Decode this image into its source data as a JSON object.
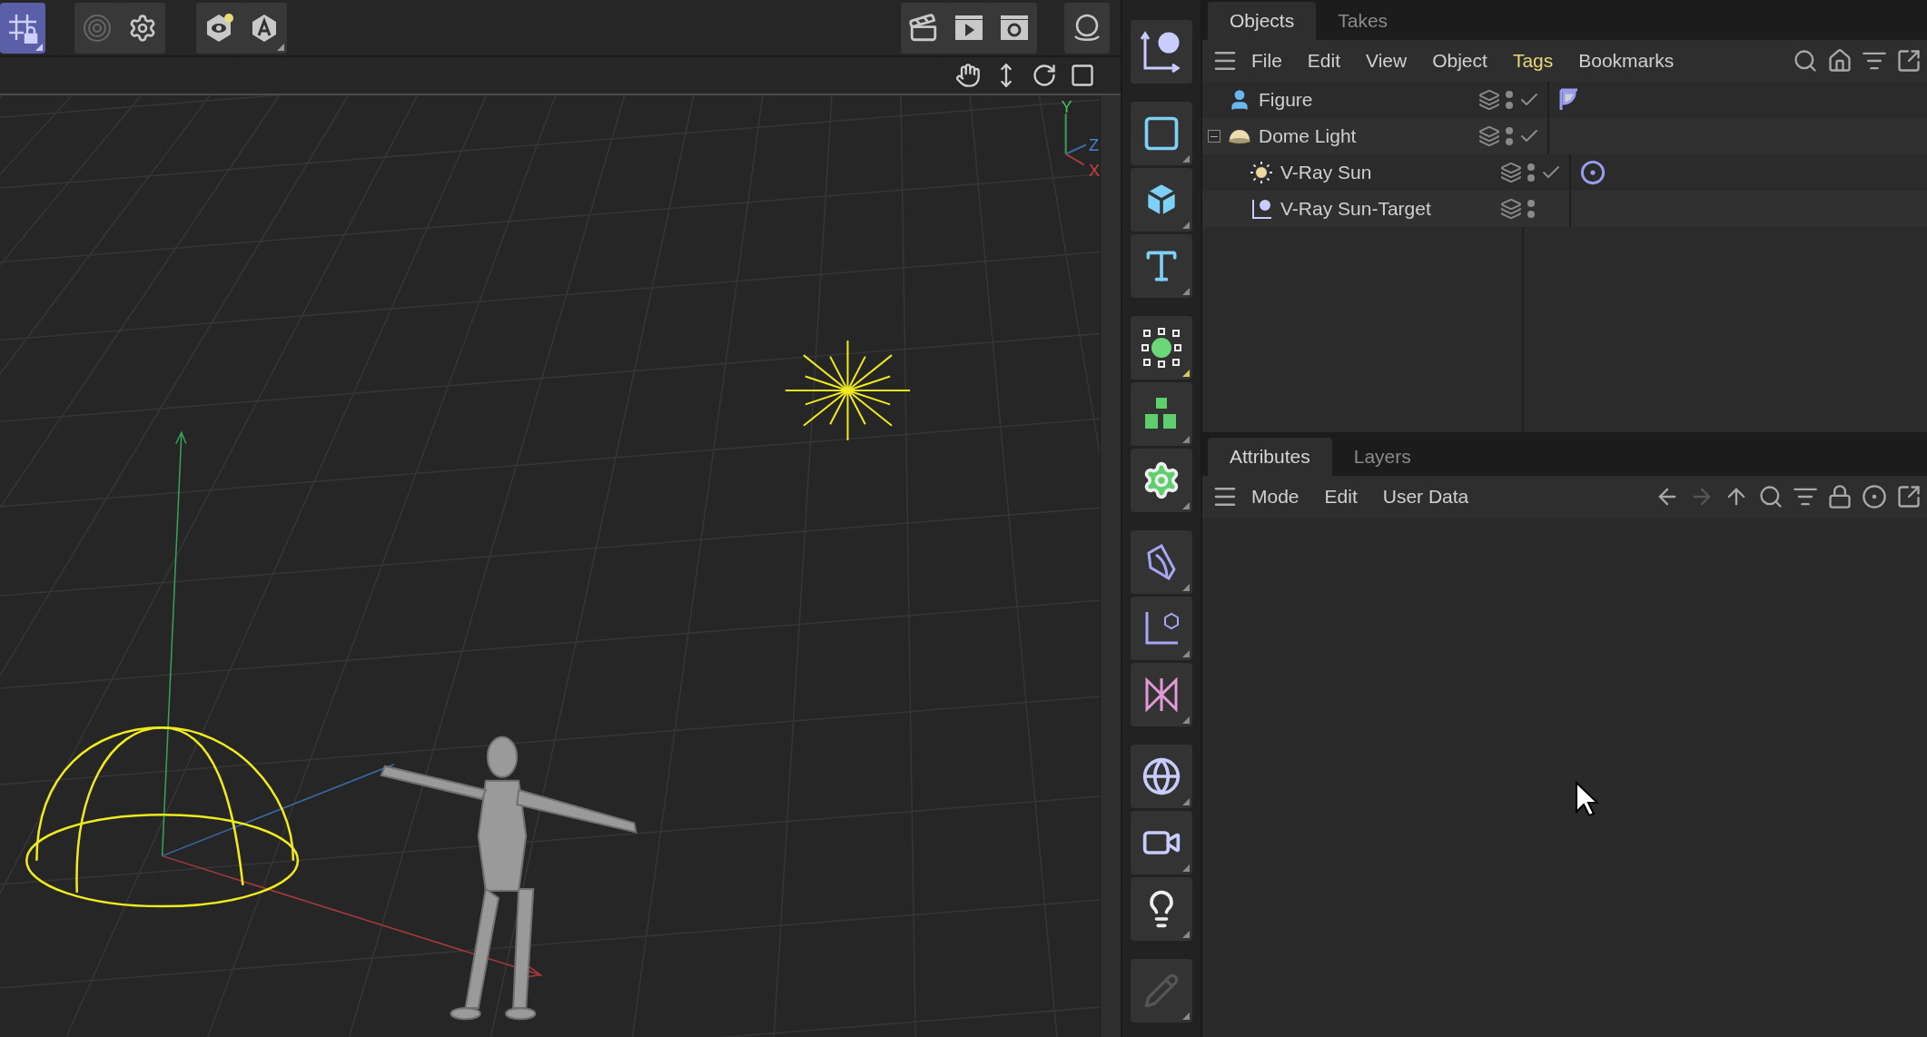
{
  "toolbar": {
    "left": [
      {
        "kind": "snap",
        "selected": true
      },
      {
        "kind": "rings",
        "selected": false
      },
      {
        "kind": "gear",
        "selected": false
      },
      {
        "kind": "eye",
        "selected": false
      },
      {
        "kind": "letter",
        "selected": false
      }
    ],
    "right": [
      {
        "kind": "clapper",
        "selected": false
      },
      {
        "kind": "play",
        "selected": false
      },
      {
        "kind": "render-settings",
        "selected": false
      },
      {
        "kind": "bulb-round",
        "selected": false
      }
    ]
  },
  "viewport": {
    "axis_labels": [
      "Y",
      "Z",
      "X"
    ]
  },
  "tool_strip": [
    {
      "tools": [
        {
          "kind": "null"
        }
      ]
    },
    {
      "tools": [
        {
          "kind": "square"
        },
        {
          "kind": "cube"
        },
        {
          "kind": "text"
        }
      ]
    },
    {
      "tools": [
        {
          "kind": "points"
        },
        {
          "kind": "blocks"
        },
        {
          "kind": "cog"
        }
      ]
    },
    {
      "tools": [
        {
          "kind": "deform"
        },
        {
          "kind": "axis-cube"
        },
        {
          "kind": "bowtie"
        }
      ]
    },
    {
      "tools": [
        {
          "kind": "globe"
        },
        {
          "kind": "camera"
        },
        {
          "kind": "light"
        }
      ]
    },
    {
      "tools": [
        {
          "kind": "pencil"
        }
      ]
    }
  ],
  "objects_panel": {
    "tabs": [
      {
        "label": "Objects",
        "selected": true
      },
      {
        "label": "Takes",
        "selected": false
      }
    ],
    "menu": [
      {
        "label": "File",
        "highlighted": false
      },
      {
        "label": "Edit",
        "highlighted": false
      },
      {
        "label": "View",
        "highlighted": false
      },
      {
        "label": "Object",
        "highlighted": false
      },
      {
        "label": "Tags",
        "highlighted": true
      },
      {
        "label": "Bookmarks",
        "highlighted": false
      }
    ],
    "tree": [
      {
        "name": "Figure",
        "kind": "figure",
        "enabled": true,
        "tags": [
          {
            "kind": "display"
          }
        ]
      },
      {
        "name": "Dome Light",
        "kind": "dome",
        "enabled": true,
        "expanded": true,
        "children": [
          {
            "name": "V-Ray Sun",
            "kind": "sun",
            "enabled": true,
            "tags": [
              {
                "kind": "target"
              }
            ]
          },
          {
            "name": "V-Ray Sun-Target",
            "kind": "null",
            "enabled": false
          }
        ]
      }
    ]
  },
  "attributes_panel": {
    "tabs": [
      {
        "label": "Attributes",
        "selected": true
      },
      {
        "label": "Layers",
        "selected": false
      }
    ],
    "menu": [
      {
        "label": "Mode"
      },
      {
        "label": "Edit"
      },
      {
        "label": "User Data"
      }
    ],
    "nav": [
      {
        "kind": "back",
        "disabled": false
      },
      {
        "kind": "forward",
        "disabled": true
      },
      {
        "kind": "up",
        "disabled": false
      }
    ]
  }
}
